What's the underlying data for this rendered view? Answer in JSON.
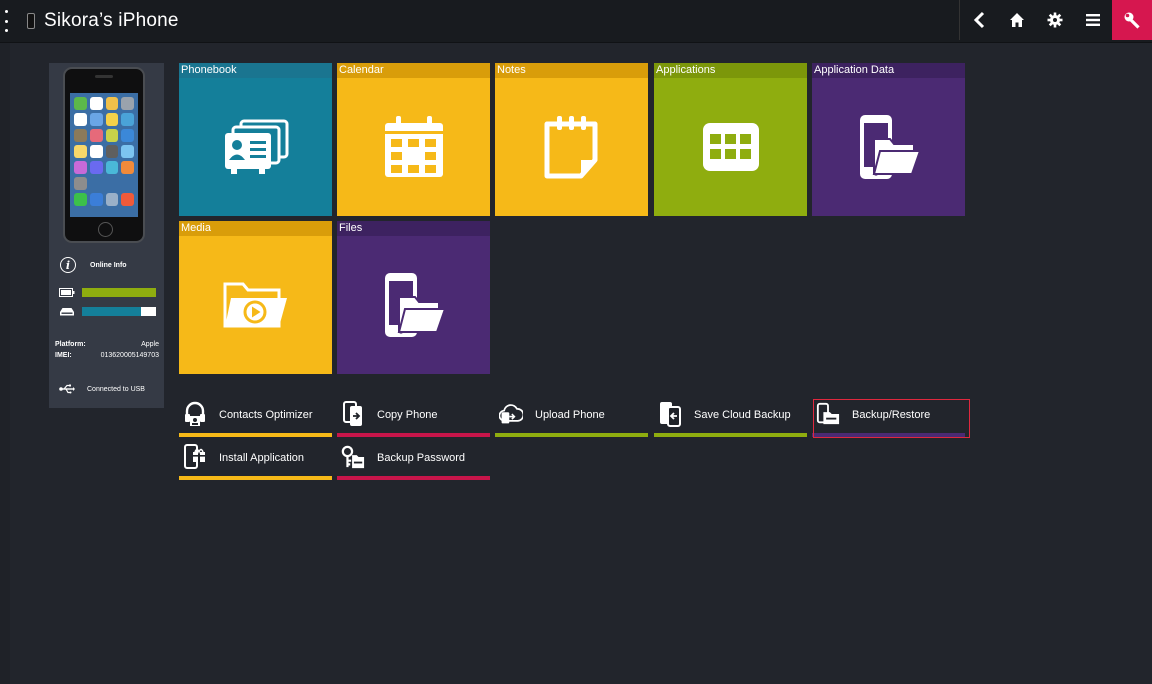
{
  "header": {
    "title": "Sikora’s iPhone",
    "toolbar": [
      {
        "name": "back-icon",
        "label": "back"
      },
      {
        "name": "home-icon",
        "label": "home"
      },
      {
        "name": "gear-icon",
        "label": "settings"
      },
      {
        "name": "list-icon",
        "label": "menu"
      },
      {
        "name": "wrench-icon",
        "label": "tools"
      }
    ],
    "accent": "#d6174f"
  },
  "device": {
    "online_info": "Online Info",
    "battery_level": 1.0,
    "storage_used": 0.8,
    "battery_color": "#8fad0f",
    "storage_color": "#147f9a",
    "platform_label": "Platform:",
    "platform_value": "Apple",
    "imei_label": "IMEI:",
    "imei_value": "013620005149703",
    "connection": "Connected to USB"
  },
  "tiles": [
    {
      "label": "Phonebook",
      "icon": "contacts-icon",
      "color": "#147f9a",
      "head": "#1a7590"
    },
    {
      "label": "Calendar",
      "icon": "calendar-icon",
      "color": "#f6b918",
      "head": "#d99d0a"
    },
    {
      "label": "Notes",
      "icon": "notes-icon",
      "color": "#f6b918",
      "head": "#d99d0a"
    },
    {
      "label": "Applications",
      "icon": "apps-grid-icon",
      "color": "#8fad0f",
      "head": "#7c970a"
    },
    {
      "label": "Application Data",
      "icon": "phone-folder-icon",
      "color": "#4b2a73",
      "head": "#3d2260"
    },
    {
      "label": "Media",
      "icon": "media-folder-icon",
      "color": "#f6b918",
      "head": "#d99d0a"
    },
    {
      "label": "Files",
      "icon": "phone-folder-icon",
      "color": "#4b2a73",
      "head": "#3d2260"
    }
  ],
  "actions": [
    {
      "label": "Contacts Optimizer",
      "icon": "contacts-optimizer-icon",
      "color": "#f6b918"
    },
    {
      "label": "Copy Phone",
      "icon": "copy-phone-icon",
      "color": "#c8154a"
    },
    {
      "label": "Upload Phone",
      "icon": "upload-phone-icon",
      "color": "#8fad0f"
    },
    {
      "label": "Save Cloud Backup",
      "icon": "cloud-backup-icon",
      "color": "#8fad0f"
    },
    {
      "label": "Backup/Restore",
      "icon": "backup-restore-icon",
      "color": "#4b2a73",
      "selected": true
    },
    {
      "label": "Install Application",
      "icon": "install-app-icon",
      "color": "#f6b918"
    },
    {
      "label": "Backup Password",
      "icon": "backup-password-icon",
      "color": "#c8154a"
    }
  ]
}
